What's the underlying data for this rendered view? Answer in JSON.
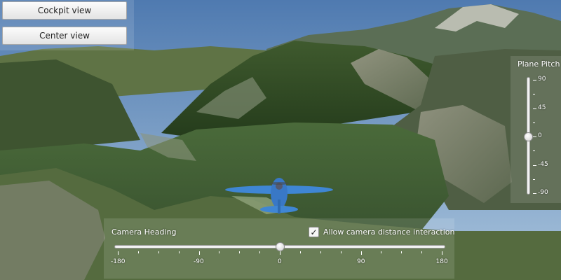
{
  "buttons": {
    "cockpit_label": "Cockpit view",
    "center_label": "Center view"
  },
  "camera_heading": {
    "label": "Camera Heading",
    "value": 0,
    "min": -180,
    "max": 180,
    "tick_labels": [
      "-180",
      "-90",
      "0",
      "90",
      "180"
    ]
  },
  "camera_distance": {
    "label": "Allow camera distance interaction",
    "checked": true,
    "check_glyph": "✓"
  },
  "plane_pitch": {
    "label": "Plane Pitch",
    "value": 0,
    "min": -90,
    "max": 90,
    "tick_labels": [
      "90",
      "45",
      "0",
      "-45",
      "-90"
    ]
  },
  "icons": [
    "airplane-icon",
    "checkmark-icon"
  ]
}
